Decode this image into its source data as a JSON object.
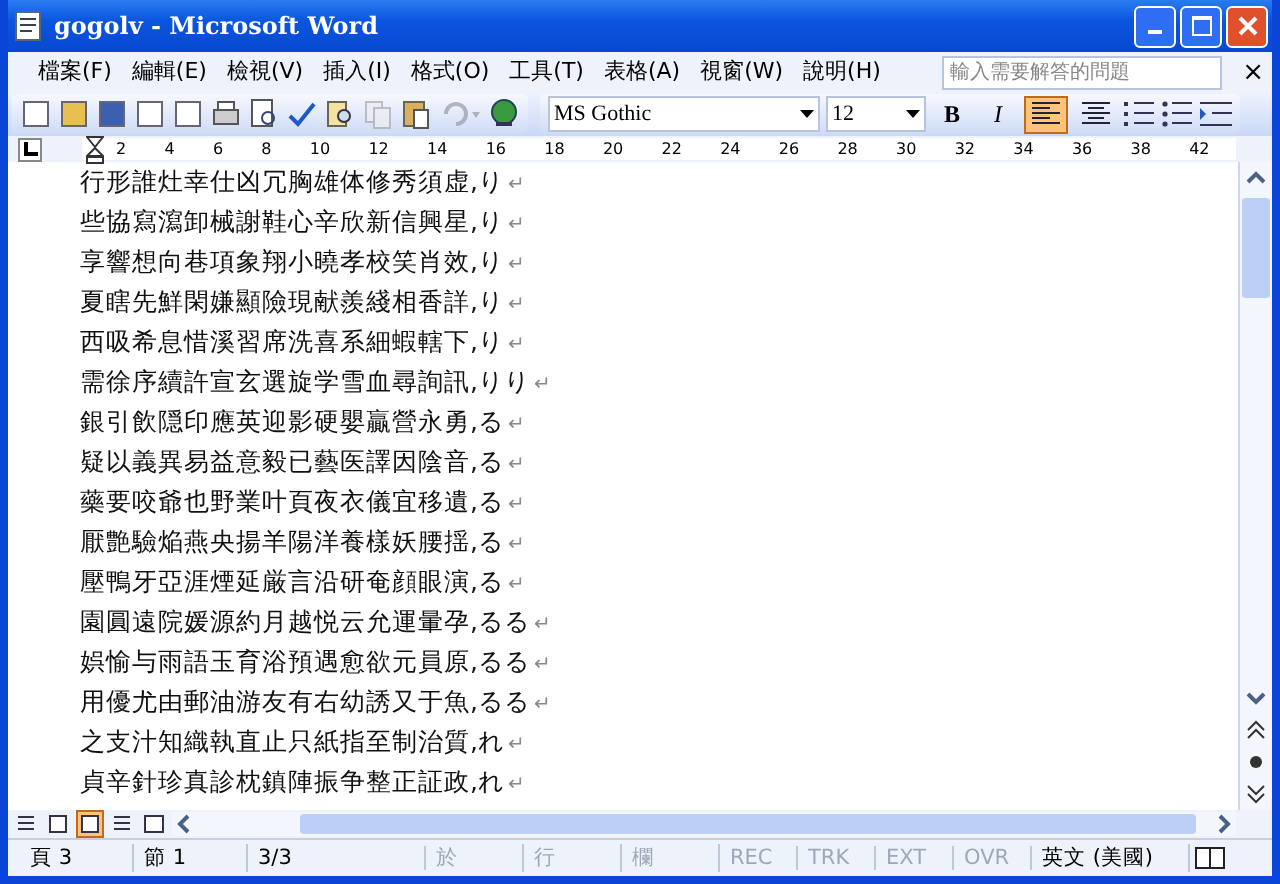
{
  "window": {
    "title": "gogolv - Microsoft Word"
  },
  "menu": {
    "items": [
      "檔案(F)",
      "編輯(E)",
      "檢視(V)",
      "插入(I)",
      "格式(O)",
      "工具(T)",
      "表格(A)",
      "視窗(W)",
      "說明(H)"
    ],
    "help_search": {
      "placeholder": "輸入需要解答的問題"
    },
    "close_label": "×"
  },
  "toolbar": {
    "font": "MS Gothic",
    "size": "12",
    "bold": "B",
    "italic": "I",
    "align": [
      {
        "kind": "left",
        "selected": true
      },
      {
        "kind": "center",
        "selected": false
      }
    ]
  },
  "ruler": {
    "numbers": [
      "2",
      "4",
      "6",
      "8",
      "10",
      "12",
      "14",
      "16",
      "18",
      "20",
      "22",
      "24",
      "26",
      "28",
      "30",
      "32",
      "34",
      "36",
      "38",
      "42"
    ]
  },
  "document": {
    "lines": [
      {
        "text": "行形誰灶幸仕凶冗胸雄体修秀須虚,り",
        "mark": "↵"
      },
      {
        "text": "些協寫瀉卸械謝鞋心辛欣新信興星,り",
        "mark": "↵"
      },
      {
        "text": "享響想向巷項象翔小曉孝校笑肖效,り",
        "mark": "↵"
      },
      {
        "text": "夏瞎先鮮閑嫌顯險現献羨綫相香詳,り",
        "mark": "↵"
      },
      {
        "text": "西吸希息惜溪習席洗喜系細蝦轄下,り",
        "mark": "↵"
      },
      {
        "text": "需徐序續許宣玄選旋学雪血尋詢訊,りり",
        "mark": "↵"
      },
      {
        "text": "銀引飲隠印應英迎影硬嬰贏營永勇,る",
        "mark": "↵"
      },
      {
        "text": "疑以義異易益意毅已藝医譯因陰音,る",
        "mark": "↵"
      },
      {
        "text": "藥要咬爺也野業叶頁夜衣儀宜移遺,る",
        "mark": "↵"
      },
      {
        "text": "厭艶驗焔燕央揚羊陽洋養樣妖腰揺,る",
        "mark": "↵"
      },
      {
        "text": "壓鴨牙亞涯煙延厳言沿研奄顔眼演,る",
        "mark": "↵"
      },
      {
        "text": "園圓遠院媛源約月越悦云允運暈孕,るる",
        "mark": "↵"
      },
      {
        "text": "娯愉与雨語玉育浴預遇愈欲元員原,るる",
        "mark": "↵"
      },
      {
        "text": "用優尤由郵油游友有右幼誘又于魚,るる",
        "mark": "↵"
      },
      {
        "text": "之支汁知織執直止只紙指至制治質,れ",
        "mark": "↵"
      },
      {
        "text": "貞辛針珍真診枕鎮陣振争整正証政,れ",
        "mark": "↵"
      }
    ]
  },
  "views": [
    {
      "kind": "normal",
      "selected": false
    },
    {
      "kind": "web",
      "selected": false
    },
    {
      "kind": "print",
      "selected": true
    },
    {
      "kind": "outline",
      "selected": false
    },
    {
      "kind": "reading",
      "selected": false
    }
  ],
  "status_bar": [
    {
      "text": "頁 3",
      "disabled": false
    },
    {
      "text": "節 1",
      "disabled": false
    },
    {
      "text": "3/3",
      "disabled": false
    },
    {
      "text": "於",
      "disabled": true
    },
    {
      "text": "行",
      "disabled": true
    },
    {
      "text": "欄",
      "disabled": true
    },
    {
      "text": "REC",
      "disabled": true
    },
    {
      "text": "TRK",
      "disabled": true
    },
    {
      "text": "EXT",
      "disabled": true
    },
    {
      "text": "OVR",
      "disabled": true
    },
    {
      "text": "英文 (美國)",
      "disabled": false
    }
  ]
}
